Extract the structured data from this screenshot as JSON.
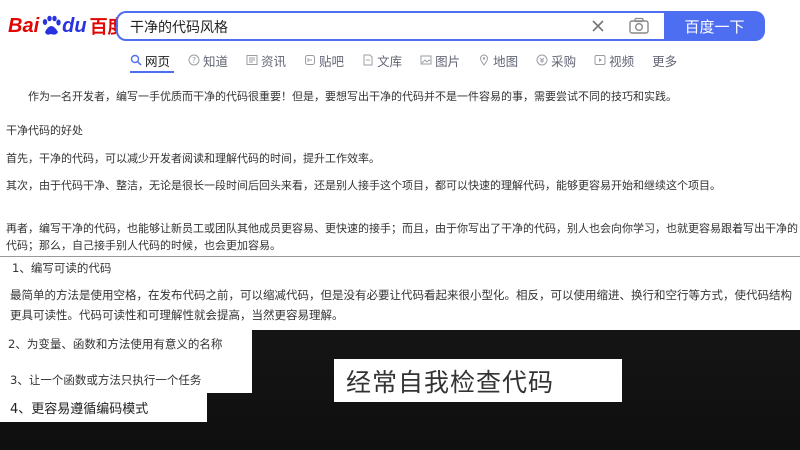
{
  "logo": {
    "part1": "Bai",
    "part2": "du",
    "part3": "百度"
  },
  "search": {
    "query": "干净的代码风格",
    "button_label": "百度一下"
  },
  "tabs": [
    {
      "label": "网页",
      "icon": "search-icon",
      "active": true
    },
    {
      "label": "知道",
      "icon": "question-icon"
    },
    {
      "label": "资讯",
      "icon": "news-icon"
    },
    {
      "label": "贴吧",
      "icon": "tieba-icon"
    },
    {
      "label": "文库",
      "icon": "document-icon"
    },
    {
      "label": "图片",
      "icon": "image-icon"
    },
    {
      "label": "地图",
      "icon": "map-pin-icon"
    },
    {
      "label": "采购",
      "icon": "purchase-icon"
    },
    {
      "label": "视频",
      "icon": "play-icon"
    },
    {
      "label": "更多",
      "icon": ""
    }
  ],
  "article": {
    "p1": "作为一名开发者，编写一手优质而干净的代码很重要！但是，要想写出干净的代码并不是一件容易的事，需要尝试不同的技巧和实践。",
    "heading": "干净代码的好处",
    "p2": "首先，干净的代码，可以减少开发者阅读和理解代码的时间，提升工作效率。",
    "p3": "其次，由于代码干净、整洁，无论是很长一段时间后回头来看，还是别人接手这个项目，都可以快速的理解代码，能够更容易开始和继续这个项目。",
    "p4": "再者，编写干净的代码，也能够让新员工或团队其他成员更容易、更快速的接手；而且，由于你写出了干净的代码，别人也会向你学习，也就更容易跟着写出干净的代码；那么，自己接手别人代码的时候，也会更加容易。"
  },
  "items": {
    "item1": "1、编写可读的代码",
    "p5": "最简单的方法是使用空格，在发布代码之前，可以缩减代码，但是没有必要让代码看起来很小型化。相反，可以使用缩进、换行和空行等方式，使代码结构更具可读性。代码可读性和可理解性就会提高，当然更容易理解。",
    "item2": "2、为变量、函数和方法使用有意义的名称",
    "item3": "3、让一个函数或方法只执行一个任务",
    "item4": "4、更容易遵循编码模式"
  },
  "caption": "经常自我检查代码",
  "colors": {
    "brand_blue": "#4e6ef2",
    "baidu_red": "#e10601",
    "baidu_blue": "#2932e1"
  }
}
